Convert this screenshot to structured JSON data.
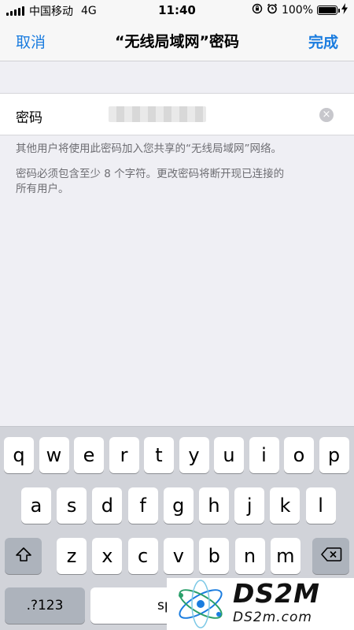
{
  "status_bar": {
    "carrier": "中国移动",
    "network": "4G",
    "time": "11:40",
    "battery": "100%",
    "battery_level": 1.0
  },
  "nav": {
    "cancel_label": "取消",
    "title": "“无线局域网”密码",
    "done_label": "完成"
  },
  "password_field": {
    "label": "密码",
    "value": "••••••••••"
  },
  "footer": {
    "line1": "其他用户将使用此密码加入您共享的“无线局域网”网络。",
    "line2a": "密码必须包含至少 8 个字符。更改密码将断开现已连接的",
    "line2b": "所有用户。"
  },
  "keyboard": {
    "row1": [
      "q",
      "w",
      "e",
      "r",
      "t",
      "y",
      "u",
      "i",
      "o",
      "p"
    ],
    "row2": [
      "a",
      "s",
      "d",
      "f",
      "g",
      "h",
      "j",
      "k",
      "l"
    ],
    "row3": [
      "z",
      "x",
      "c",
      "v",
      "b",
      "n",
      "m"
    ],
    "numbers_label": ".?123",
    "space_label": "sp"
  },
  "watermark": {
    "brand": "DS2M",
    "domain": "DS2m.com"
  },
  "colors": {
    "accent": "#1a7cdf",
    "background": "#efeff4",
    "keyboard_bg": "#d1d3d9"
  }
}
